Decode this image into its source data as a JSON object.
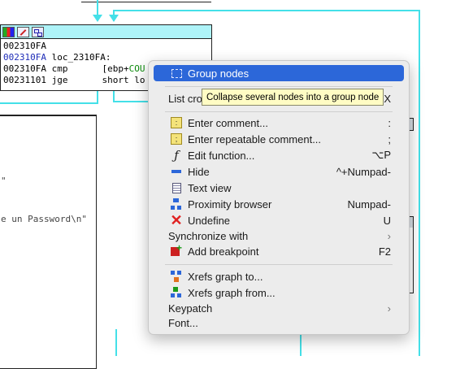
{
  "graph": {
    "node_main": {
      "lines": [
        {
          "addr": "002310FA",
          "text": ""
        },
        {
          "addr": "002310FA",
          "text": " loc_2310FA:"
        },
        {
          "addr": "002310FA",
          "text": " cmp",
          "operand": "[ebp+",
          "operand_green": "COU"
        },
        {
          "addr": "00231101",
          "text": " jge",
          "operand": "short lo",
          "operand_green": ""
        }
      ]
    },
    "left_node_fragments": {
      "quote_1": "\"",
      "password_text": "e un Password\\n\""
    }
  },
  "context_menu": {
    "items": [
      {
        "label": "Group nodes",
        "shortcut": "",
        "icon": "group-nodes-icon"
      },
      {
        "label": "List cro",
        "shortcut": "X",
        "icon": ""
      },
      {
        "label": "Enter comment...",
        "shortcut": ":",
        "icon": "comment-icon"
      },
      {
        "label": "Enter repeatable comment...",
        "shortcut": ";",
        "icon": "repeatable-comment-icon"
      },
      {
        "label": "Edit function...",
        "shortcut": "⌥P",
        "icon": "function-icon"
      },
      {
        "label": "Hide",
        "shortcut": "^+Numpad-",
        "icon": "hide-icon"
      },
      {
        "label": "Text view",
        "shortcut": "",
        "icon": "text-view-icon"
      },
      {
        "label": "Proximity browser",
        "shortcut": "Numpad-",
        "icon": "proximity-browser-icon"
      },
      {
        "label": "Undefine",
        "shortcut": "U",
        "icon": "undefine-icon"
      },
      {
        "label": "Synchronize with",
        "shortcut": "›",
        "icon": ""
      },
      {
        "label": "Add breakpoint",
        "shortcut": "F2",
        "icon": "breakpoint-icon"
      },
      {
        "label": "Xrefs graph to...",
        "shortcut": "",
        "icon": "xrefs-to-icon"
      },
      {
        "label": "Xrefs graph from...",
        "shortcut": "",
        "icon": "xrefs-from-icon"
      },
      {
        "label": "Keypatch",
        "shortcut": "›",
        "icon": ""
      },
      {
        "label": "Font...",
        "shortcut": "",
        "icon": ""
      }
    ]
  },
  "tooltip": {
    "text": "Collapse several nodes into a group node"
  },
  "colors": {
    "edge": "#44e0e8",
    "node_header": "#aef3f8",
    "highlight": "#2c67d9",
    "tooltip_bg": "#fffcc4"
  }
}
